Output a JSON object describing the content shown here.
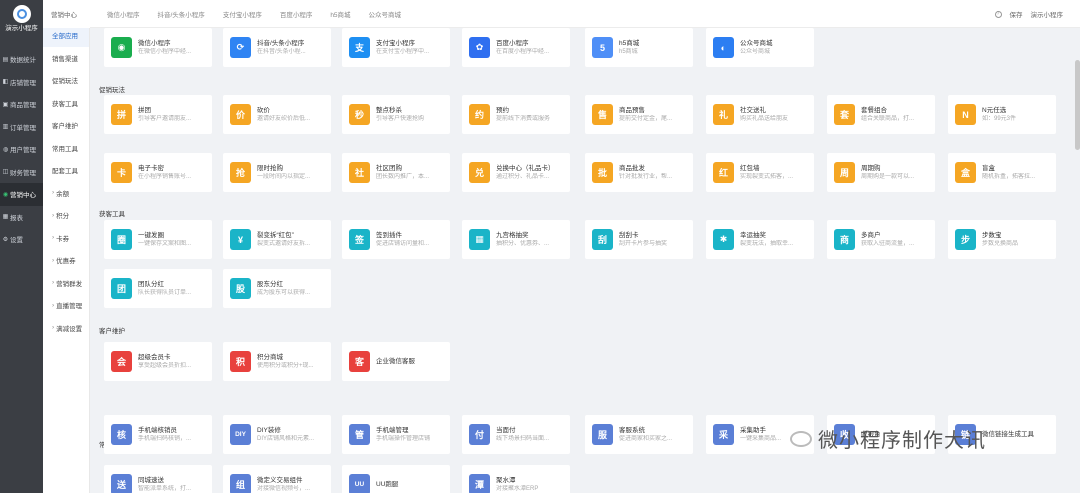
{
  "sidebar": {
    "app_name": "演示小程序",
    "items": [
      {
        "label": "数据统计",
        "icon": "chart-icon"
      },
      {
        "label": "店铺管理",
        "icon": "store-icon"
      },
      {
        "label": "商品管理",
        "icon": "goods-icon"
      },
      {
        "label": "订单管理",
        "icon": "order-icon"
      },
      {
        "label": "用户管理",
        "icon": "user-icon"
      },
      {
        "label": "财务管理",
        "icon": "finance-icon"
      },
      {
        "label": "营销中心",
        "icon": "marketing-icon",
        "active": true
      },
      {
        "label": "报表",
        "icon": "report-icon"
      },
      {
        "label": "设置",
        "icon": "gear-icon"
      }
    ]
  },
  "header": {
    "section_label": "营销中心"
  },
  "subnav": {
    "items": [
      "全部应用",
      "销售渠道",
      "促销玩法",
      "获客工具",
      "客户维护",
      "常用工具",
      "配套工具",
      "余额",
      "积分",
      "卡券",
      "优惠券",
      "营销群发",
      "直播管理",
      "满减设置"
    ]
  },
  "topbar": {
    "tabs": [
      "微信小程序",
      "抖音/头条小程序",
      "支付宝小程序",
      "百度小程序",
      "h5商城",
      "公众号商城"
    ],
    "save_label": "保存",
    "account": "演示小程序"
  },
  "sections": [
    {
      "title": "",
      "cards": [
        {
          "name": "微信小程序",
          "desc": "在微信小程序中经...",
          "color": "#1aad4e",
          "glyph": "◉"
        },
        {
          "name": "抖音/头条小程序",
          "desc": "在抖音/头条小程...",
          "color": "#2f84f3",
          "glyph": "⟳"
        },
        {
          "name": "支付宝小程序",
          "desc": "在支付宝小程序中...",
          "color": "#1e8ff2",
          "glyph": "支"
        },
        {
          "name": "百度小程序",
          "desc": "在百度小程序中经...",
          "color": "#2f6ff0",
          "glyph": "✿"
        },
        {
          "name": "h5商城",
          "desc": "h5商城",
          "color": "#4f8ff7",
          "glyph": "5"
        },
        {
          "name": "公众号商城",
          "desc": "公众号商城",
          "color": "#2c7ef2",
          "glyph": "◐"
        }
      ]
    },
    {
      "title": "促销玩法",
      "cards": [
        {
          "name": "拼团",
          "desc": "引导客户邀请朋友...",
          "color": "#f5a623",
          "glyph": "拼"
        },
        {
          "name": "砍价",
          "desc": "邀请好友砍价后低...",
          "color": "#f5a623",
          "glyph": "价"
        },
        {
          "name": "整点秒杀",
          "desc": "引导客户快速抢购",
          "color": "#f5a623",
          "glyph": "秒"
        },
        {
          "name": "预约",
          "desc": "提前线下消费或服务",
          "color": "#f5a623",
          "glyph": "约"
        },
        {
          "name": "商品预售",
          "desc": "提前交付定金，尾...",
          "color": "#f5a623",
          "glyph": "售"
        },
        {
          "name": "社交送礼",
          "desc": "购买礼品送给朋友",
          "color": "#f5a623",
          "glyph": "礼"
        },
        {
          "name": "套餐组合",
          "desc": "组合关联商品，打...",
          "color": "#f5a623",
          "glyph": "套"
        },
        {
          "name": "N元任选",
          "desc": "如：99元3件",
          "color": "#f5a623",
          "glyph": "N"
        },
        {
          "name": "电子卡密",
          "desc": "在小程序销售账号...",
          "color": "#f5a623",
          "glyph": "卡"
        },
        {
          "name": "限时抢购",
          "desc": "一段时间内以指定...",
          "color": "#f5a623",
          "glyph": "抢"
        },
        {
          "name": "社区团购",
          "desc": "团长数内推广，本...",
          "color": "#f5a623",
          "glyph": "社"
        },
        {
          "name": "兑换中心（礼品卡）",
          "desc": "通过积分、礼品卡...",
          "color": "#f5a623",
          "glyph": "兑"
        },
        {
          "name": "商品批发",
          "desc": "针对批发行业，帮...",
          "color": "#f5a623",
          "glyph": "批"
        },
        {
          "name": "红包墙",
          "desc": "实现裂变式拓客，...",
          "color": "#f5a623",
          "glyph": "红"
        },
        {
          "name": "周期购",
          "desc": "周期购是一款可以...",
          "color": "#f5a623",
          "glyph": "周"
        },
        {
          "name": "盲盒",
          "desc": "随机拆盒，拓客拉...",
          "color": "#f5a623",
          "glyph": "盒"
        }
      ]
    },
    {
      "title": "获客工具",
      "cards": [
        {
          "name": "一键发圈",
          "desc": "一键保存文案和图...",
          "color": "#1ab4c8",
          "glyph": "圈"
        },
        {
          "name": "裂变拆“红包”",
          "desc": "裂变式邀请好友拆...",
          "color": "#1ab4c8",
          "glyph": "¥"
        },
        {
          "name": "签到插件",
          "desc": "促进店铺访问量和...",
          "color": "#1ab4c8",
          "glyph": "签"
        },
        {
          "name": "九宫格抽奖",
          "desc": "抽积分、优惠券、...",
          "color": "#1ab4c8",
          "glyph": "▦"
        },
        {
          "name": "刮刮卡",
          "desc": "刮开卡片参与抽奖",
          "color": "#1ab4c8",
          "glyph": "刮"
        },
        {
          "name": "幸运抽奖",
          "desc": "裂变玩法，抽取幸...",
          "color": "#1ab4c8",
          "glyph": "✱"
        },
        {
          "name": "多商户",
          "desc": "获取入驻商流量，...",
          "color": "#1ab4c8",
          "glyph": "商"
        },
        {
          "name": "步数宝",
          "desc": "步数兑换商品",
          "color": "#1ab4c8",
          "glyph": "步"
        },
        {
          "name": "团队分红",
          "desc": "队长获得队员订单...",
          "color": "#1ab4c8",
          "glyph": "团"
        },
        {
          "name": "股东分红",
          "desc": "成为股东可以获得...",
          "color": "#1ab4c8",
          "glyph": "股"
        }
      ]
    },
    {
      "title": "客户维护",
      "cards": [
        {
          "name": "超级会员卡",
          "desc": "享受超级会员折扣...",
          "color": "#e8413d",
          "glyph": "会"
        },
        {
          "name": "积分商城",
          "desc": "使用积分或积分+现...",
          "color": "#e8413d",
          "glyph": "积"
        },
        {
          "name": "企业微信客服",
          "desc": "",
          "color": "#e8413d",
          "glyph": "客"
        }
      ]
    },
    {
      "title": "常用工具",
      "cards": [
        {
          "name": "手机端核销员",
          "desc": "手机端扫码核销，...",
          "color": "#5b7fd6",
          "glyph": "核"
        },
        {
          "name": "DIY装修",
          "desc": "DIY店铺风格和元素...",
          "color": "#5b7fd6",
          "glyph": "DIY"
        },
        {
          "name": "手机端管理",
          "desc": "手机端操作管理店铺",
          "color": "#5b7fd6",
          "glyph": "管"
        },
        {
          "name": "当面付",
          "desc": "线下场景扫码当面...",
          "color": "#5b7fd6",
          "glyph": "付"
        },
        {
          "name": "客服系统",
          "desc": "促进商家和买家之...",
          "color": "#5b7fd6",
          "glyph": "服"
        },
        {
          "name": "采集助手",
          "desc": "一键采集商品...",
          "color": "#5b7fd6",
          "glyph": "采"
        },
        {
          "name": "收银台",
          "desc": "",
          "color": "#5b7fd6",
          "glyph": "收"
        },
        {
          "name": "微信链接生成工具",
          "desc": "",
          "color": "#5b7fd6",
          "glyph": "链"
        },
        {
          "name": "同城速送",
          "desc": "智能派单系统，打...",
          "color": "#5b7fd6",
          "glyph": "送"
        },
        {
          "name": "微定义交易组件",
          "desc": "对接微信视频号，...",
          "color": "#5b7fd6",
          "glyph": "组"
        },
        {
          "name": "UU跑腿",
          "desc": "",
          "color": "#5b7fd6",
          "glyph": "UU"
        },
        {
          "name": "聚水潭",
          "desc": "对接聚水潭ERP",
          "color": "#5b7fd6",
          "glyph": "潭"
        }
      ]
    }
  ],
  "watermark": "微小程序制作大讯"
}
